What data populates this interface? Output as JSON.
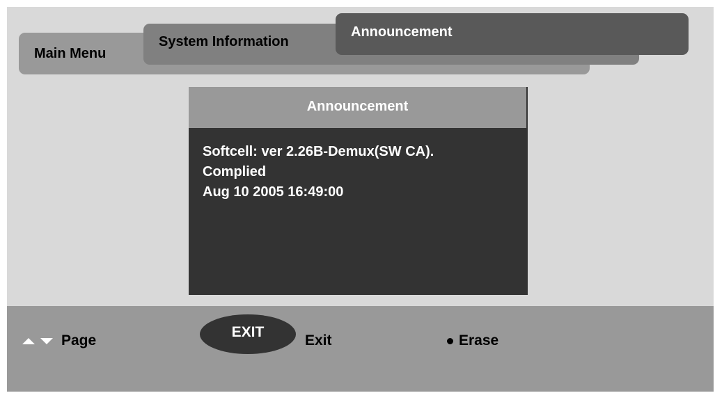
{
  "tabs": {
    "main_menu": "Main Menu",
    "system_information": "System Information",
    "announcement": "Announcement"
  },
  "dialog": {
    "title": "Announcement",
    "lines": [
      "Softcell: ver 2.26B-Demux(SW CA).",
      "Complied",
      "Aug 10 2005 16:49:00"
    ]
  },
  "footer": {
    "page_label": "Page",
    "exit_button": "EXIT",
    "exit_label": "Exit",
    "erase_label": "Erase"
  },
  "icons": {
    "page_up": "triangle-up-icon",
    "page_down": "triangle-down-icon",
    "erase": "bullet-icon"
  },
  "colors": {
    "screen_bg": "#d9d9d9",
    "tab_main": "#999999",
    "tab_system": "#808080",
    "tab_announcement": "#595959",
    "dialog_bg": "#333333",
    "dialog_header": "#999999",
    "footer_bg": "#999999"
  }
}
